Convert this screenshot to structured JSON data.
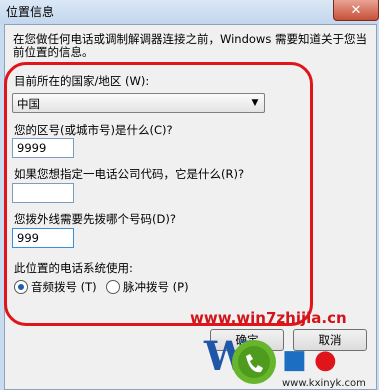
{
  "window": {
    "title": "位置信息",
    "close_label": "✕"
  },
  "intro": "在您做任何电话或调制解调器连接之前，Windows 需要知道关于您当前位置的信息。",
  "country": {
    "label": "目前所在的国家/地区 (W):",
    "value": "中国"
  },
  "area_code": {
    "label": "您的区号(或城市号)是什么(C)?",
    "value": "9999"
  },
  "carrier_code": {
    "label": "如果您想指定一电话公司代码，它是什么(R)?"
  },
  "outside_line": {
    "label": "您拨外线需要先拨哪个号码(D)?",
    "value": "999"
  },
  "dialing": {
    "label": "此位置的电话系统使用:",
    "options": [
      {
        "label": "音频拨号 (T)"
      },
      {
        "label": "脉冲拨号 (P)"
      }
    ],
    "selected": "音频拨号 (T)"
  },
  "buttons": {
    "ok": "确定",
    "cancel": "取消"
  },
  "watermark": {
    "url": "www.win7zhijia.cn",
    "site": "www.kxinyk.com"
  },
  "colors": {
    "highlight_border": "#e0141b",
    "watermark": "#d2141b",
    "radio_dot": "#1b5fae"
  }
}
